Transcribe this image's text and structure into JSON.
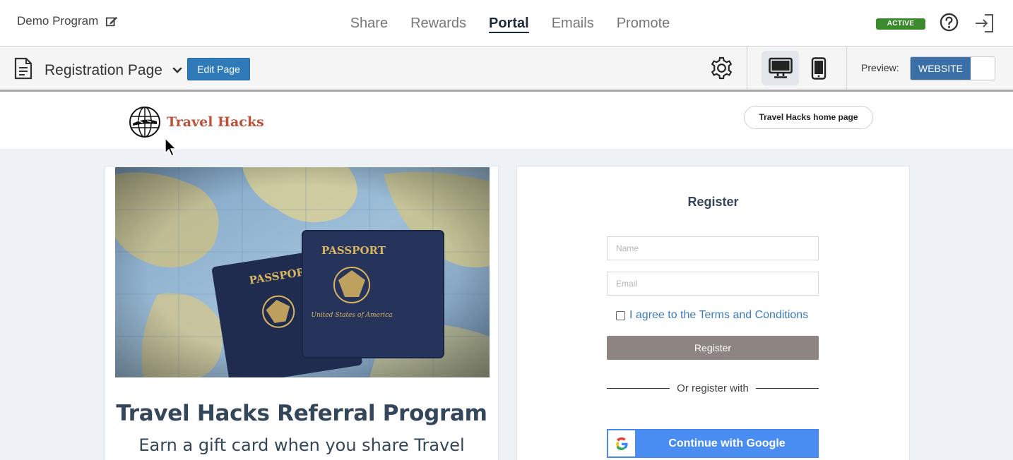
{
  "topbar": {
    "program_name": "Demo Program",
    "tabs": [
      {
        "label": "Share"
      },
      {
        "label": "Rewards"
      },
      {
        "label": "Portal"
      },
      {
        "label": "Emails"
      },
      {
        "label": "Promote"
      }
    ],
    "active_tab": "Portal",
    "status_badge": "ACTIVE",
    "status_color": "#3b8a2e"
  },
  "toolbar": {
    "page_select": "Registration Page",
    "edit_page_label": "Edit Page",
    "preview_label": "Preview:",
    "preview_mode": "WEBSITE",
    "accent": "#2f7ab9"
  },
  "portal": {
    "logo_text": "Travel Hacks",
    "home_button": "Travel Hacks home page",
    "hero_title": "Travel Hacks Referral Program",
    "hero_subtitle": "Earn a gift card when you share Travel",
    "register": {
      "title": "Register",
      "name_placeholder": "Name",
      "email_placeholder": "Email",
      "terms_label": "I agree to the Terms and Conditions",
      "register_button": "Register",
      "or_text": "Or register with",
      "google_button": "Continue with Google"
    },
    "passport_text": "PASSPORT",
    "passport_country": "United States of America"
  }
}
